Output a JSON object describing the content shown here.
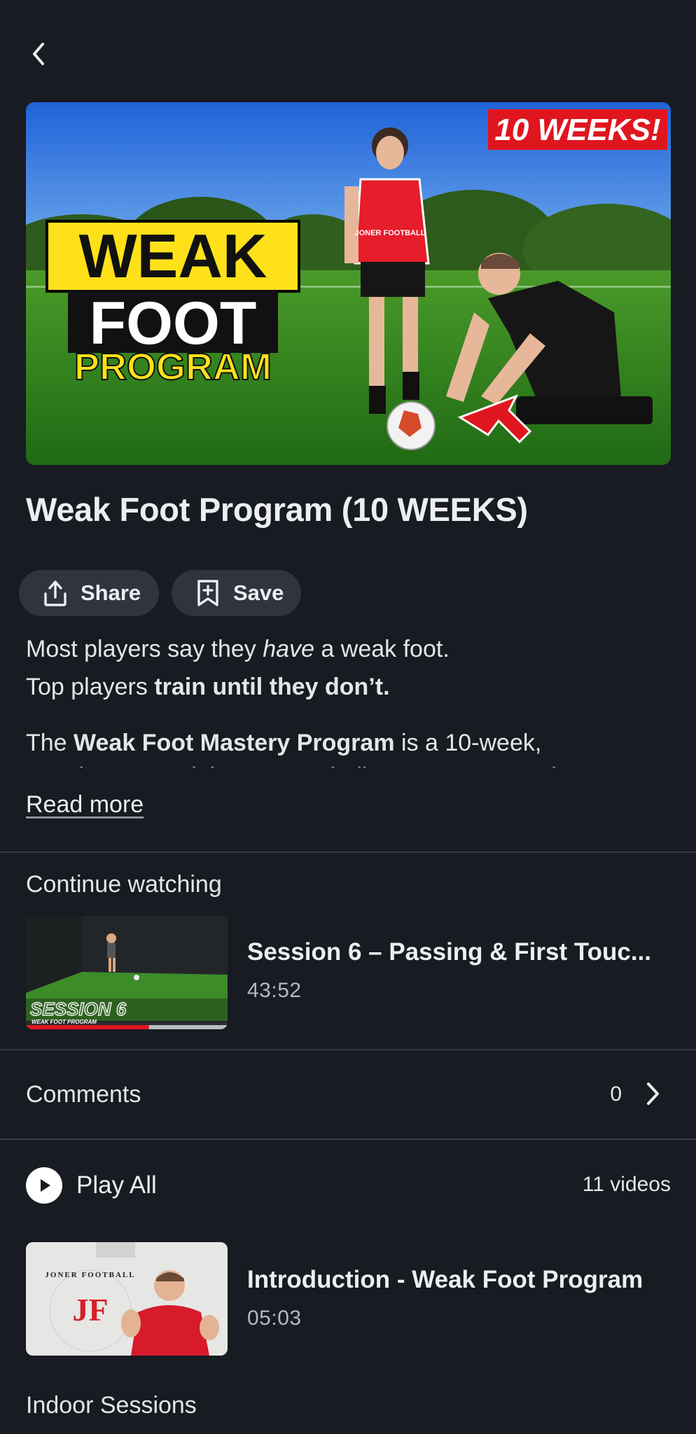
{
  "nav": {
    "back_icon": "chevron-left-icon"
  },
  "hero": {
    "badge": "10 WEEKS!",
    "line1": "WEAK",
    "line2": "FOOT",
    "line3": "PROGRAM",
    "shirt_text": "JONER FOOTBALL"
  },
  "program": {
    "title": "Weak Foot Program (10 WEEKS)"
  },
  "actions": {
    "share_label": "Share",
    "share_icon": "share-upload-icon",
    "save_label": "Save",
    "save_icon": "bookmark-plus-icon"
  },
  "description": {
    "p1_before": "Most players say they ",
    "p1_em": "have",
    "p1_after": " a weak foot.",
    "p2_before": "Top players ",
    "p2_bold": "train until they don’t.",
    "p3_before": "The ",
    "p3_bold": "Weak Foot Mastery Program",
    "p3_after": " is a 10-week,",
    "p4": "step-by-step training system built to turn your weak",
    "read_more": "Read more"
  },
  "continue_watching": {
    "label": "Continue watching",
    "video": {
      "title": "Session 6 – Passing & First Touc...",
      "duration": "43:52",
      "thumb_title": "SESSION 6",
      "thumb_subtitle": "WEAK FOOT PROGRAM",
      "progress": 0.61
    }
  },
  "comments": {
    "label": "Comments",
    "count": "0"
  },
  "playlist": {
    "play_all_label": "Play All",
    "video_count": "11 videos",
    "videos": [
      {
        "title": "Introduction - Weak Foot Program",
        "duration": "05:03",
        "logo_text": "JONER FOOTBALL",
        "logo_mark": "JF"
      }
    ],
    "next_section": "Indoor Sessions"
  },
  "colors": {
    "background": "#181b22",
    "pill": "#2f343e",
    "badge_red": "#e0161f",
    "yellow": "#ffe11a",
    "progress_red": "#e0161f"
  }
}
